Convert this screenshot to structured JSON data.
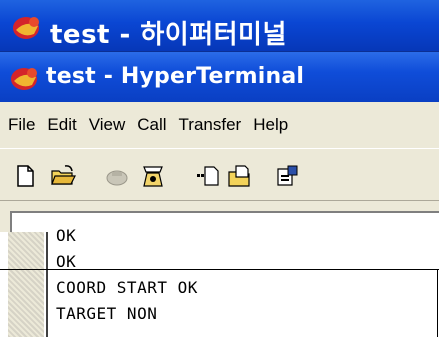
{
  "background_window": {
    "title": "test - 하이퍼터미널"
  },
  "window": {
    "title": "test - HyperTerminal"
  },
  "menu": {
    "items": [
      "File",
      "Edit",
      "View",
      "Call",
      "Transfer",
      "Help"
    ]
  },
  "toolbar": {
    "icons": [
      "new-document-icon",
      "open-folder-icon",
      "disconnect-icon",
      "call-icon",
      "send-icon",
      "receive-icon",
      "properties-icon"
    ]
  },
  "terminal": {
    "lines": [
      "OK",
      "OK",
      "COORD START OK",
      "TARGET NON"
    ]
  },
  "colors": {
    "titlebar": "#0a46d3",
    "chrome": "#ece9d8",
    "terminal_bg": "#ffffff",
    "terminal_text": "#000000"
  }
}
